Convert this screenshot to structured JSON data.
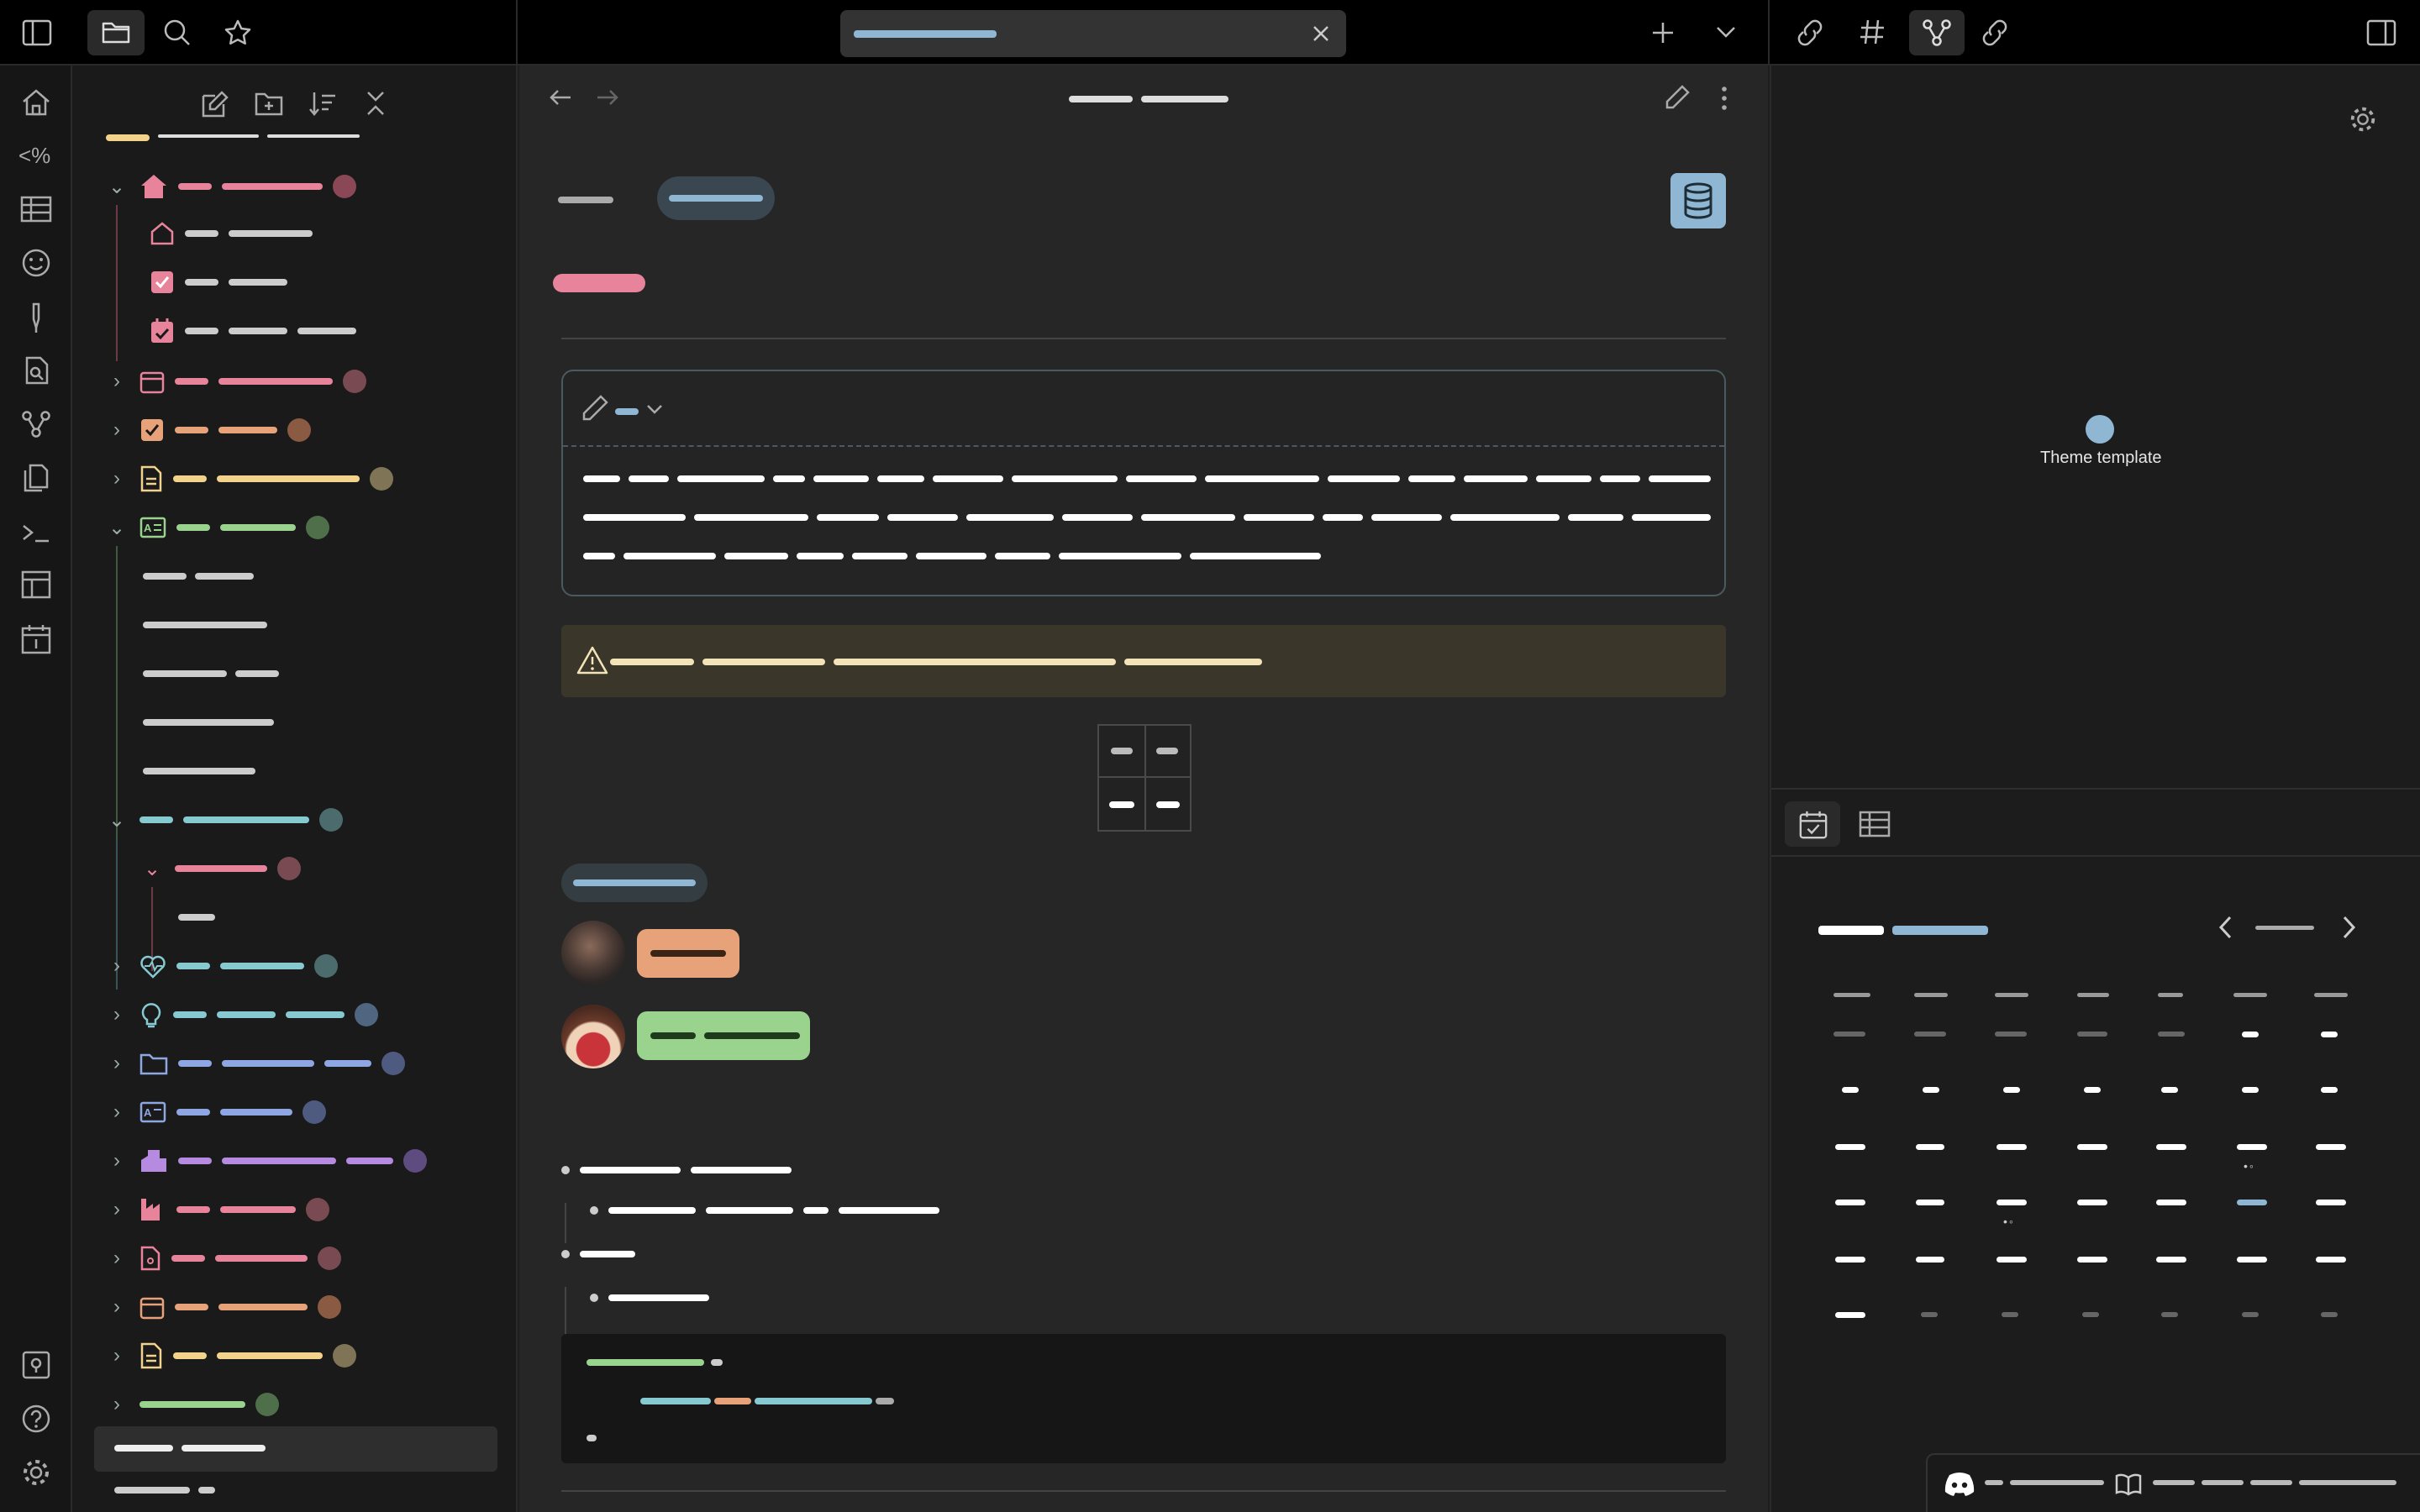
{
  "graph": {
    "node_label": "Theme template"
  },
  "colors": {
    "accent_blue": "#8fb7d4",
    "pink": "#e8839c",
    "orange": "#e7a27a",
    "yellow": "#f3d28b",
    "green": "#99d38e",
    "teal": "#86c9d1",
    "purple": "#b68ae0",
    "warning_bg": "#3a3629",
    "code_bg": "#161616"
  },
  "icons": {
    "ribbon": [
      "home-icon",
      "templater-icon",
      "table-icon",
      "smiley-icon",
      "pen-icon",
      "search-file-icon",
      "graph-icon",
      "files-icon",
      "terminal-icon",
      "layout-icon",
      "calendar-icon"
    ],
    "ribbon_bottom": [
      "vault-icon",
      "help-icon",
      "settings-icon"
    ]
  }
}
